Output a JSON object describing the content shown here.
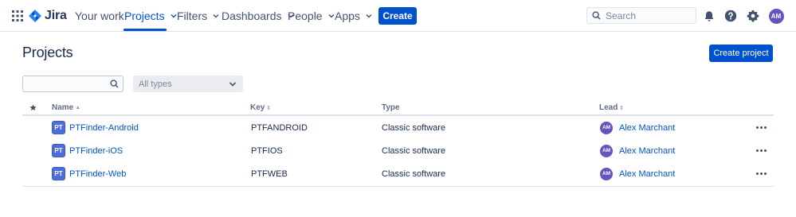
{
  "nav": {
    "logo_text": "Jira",
    "links": [
      "Your work",
      "Projects",
      "Filters",
      "Dashboards",
      "People",
      "Apps"
    ],
    "create_label": "Create",
    "search_placeholder": "Search",
    "user_initials": "AM"
  },
  "page": {
    "title": "Projects",
    "create_project_label": "Create project",
    "type_filter_value": "All types"
  },
  "table": {
    "columns": {
      "name": "Name",
      "key": "Key",
      "type": "Type",
      "lead": "Lead"
    },
    "rows": [
      {
        "icon_text": "PT",
        "name": "PTFinder-Android",
        "key": "PTFANDROID",
        "type": "Classic software",
        "lead_initials": "AM",
        "lead": "Alex Marchant"
      },
      {
        "icon_text": "PT",
        "name": "PTFinder-iOS",
        "key": "PTFIOS",
        "type": "Classic software",
        "lead_initials": "AM",
        "lead": "Alex Marchant"
      },
      {
        "icon_text": "PT",
        "name": "PTFinder-Web",
        "key": "PTFWEB",
        "type": "Classic software",
        "lead_initials": "AM",
        "lead": "Alex Marchant"
      }
    ]
  },
  "colors": {
    "brand": "#0052cc",
    "avatar": "#6554c0",
    "project_icon": "#4c6ed8"
  },
  "icons": [
    "app-switcher-icon",
    "jira-logo-icon",
    "chevron-down-icon",
    "search-icon",
    "notifications-icon",
    "help-icon",
    "settings-icon",
    "star-icon",
    "more-icon"
  ]
}
